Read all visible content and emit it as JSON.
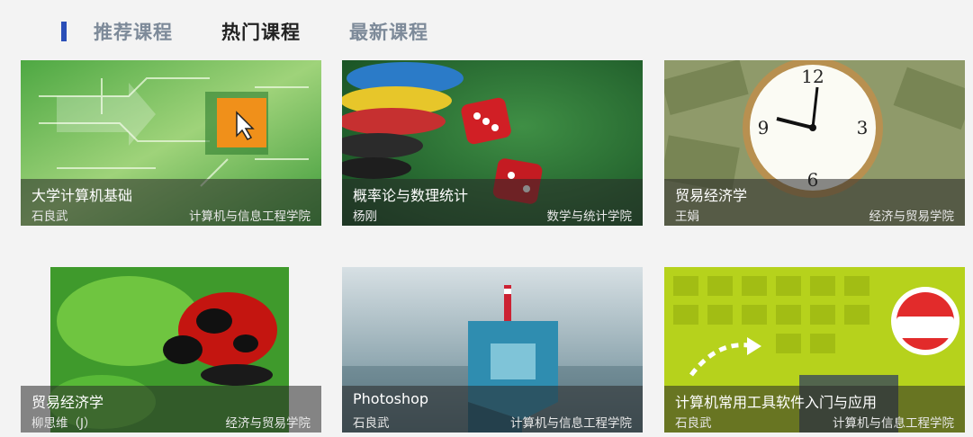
{
  "tabs": [
    {
      "label": "推荐课程",
      "active": false
    },
    {
      "label": "热门课程",
      "active": true
    },
    {
      "label": "最新课程",
      "active": false
    }
  ],
  "courses": [
    {
      "title": "大学计算机基础",
      "teacher": "石良武",
      "school": "计算机与信息工程学院",
      "image": "circuit-hand-cursor"
    },
    {
      "title": "概率论与数理统计",
      "teacher": "杨刚",
      "school": "数学与统计学院",
      "image": "dice-and-chips"
    },
    {
      "title": "贸易经济学",
      "teacher": "王娟",
      "school": "经济与贸易学院",
      "image": "clock-on-money"
    },
    {
      "title": "贸易经济学",
      "teacher": "柳思维（J）",
      "school": "经济与贸易学院",
      "image": "ladybug-leaf"
    },
    {
      "title": "Photoshop",
      "teacher": "石良武",
      "school": "计算机与信息工程学院",
      "image": "surreal-sea-tower"
    },
    {
      "title": "计算机常用工具软件入门与应用",
      "teacher": "石良武",
      "school": "计算机与信息工程学院",
      "image": "micro-lesson-computer"
    }
  ],
  "colors": {
    "tab_marker": "#2a4fb8",
    "tab_inactive": "#7d8a99",
    "tab_active": "#222222"
  }
}
